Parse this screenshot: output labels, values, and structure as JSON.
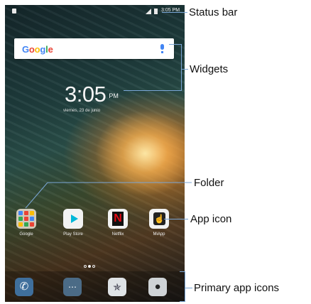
{
  "status_bar": {
    "time": "3:05 PM"
  },
  "search_widget": {
    "logo_text": "Google",
    "mic_icon": "mic-icon"
  },
  "clock_widget": {
    "time": "3:05",
    "ampm": "PM",
    "date": "viernes, 23 de junio"
  },
  "apps": [
    {
      "label": "Google",
      "icon": "folder-icon"
    },
    {
      "label": "Play Store",
      "icon": "play-store-icon"
    },
    {
      "label": "Netflix",
      "icon": "netflix-icon"
    },
    {
      "label": "MiApp",
      "icon": "miapp-icon"
    }
  ],
  "page_indicator": {
    "pages": 3,
    "active": 2
  },
  "dock": [
    {
      "icon": "phone-icon"
    },
    {
      "icon": "messages-icon"
    },
    {
      "icon": "browser-icon"
    },
    {
      "icon": "camera-icon"
    }
  ],
  "callouts": {
    "status_bar": "Status bar",
    "widgets": "Widgets",
    "folder": "Folder",
    "app_icon": "App icon",
    "primary_app_icons": "Primary app icons"
  },
  "colors": {
    "callout_line": "#7aa6d6",
    "google_blue": "#4285f4",
    "netflix_red": "#e50914"
  }
}
